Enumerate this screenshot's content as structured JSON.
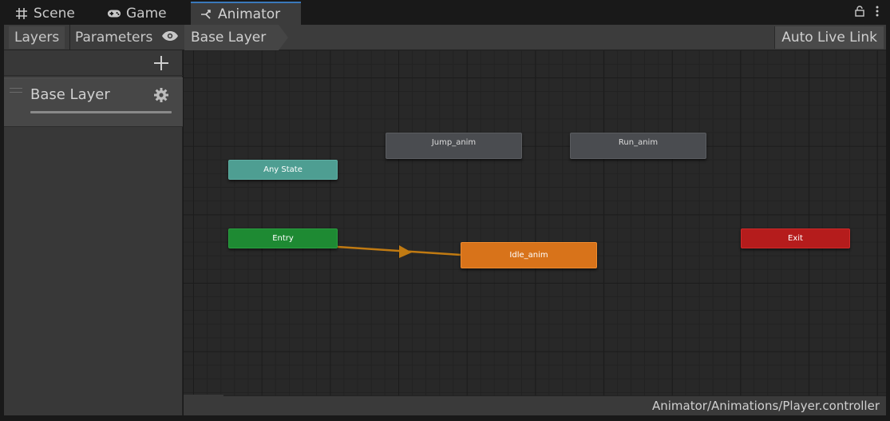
{
  "tabs": [
    {
      "label": "Scene",
      "icon": "grid-icon"
    },
    {
      "label": "Game",
      "icon": "gamepad-icon"
    },
    {
      "label": "Animator",
      "icon": "animator-icon",
      "active": true
    }
  ],
  "toolbar": {
    "layers_label": "Layers",
    "parameters_label": "Parameters",
    "breadcrumb": "Base Layer",
    "live_link_label": "Auto Live Link"
  },
  "layers": [
    {
      "name": "Base Layer"
    }
  ],
  "graph": {
    "any_state": "Any State",
    "entry": "Entry",
    "exit": "Exit",
    "states": {
      "jump": "Jump_anim",
      "run": "Run_anim",
      "idle": "Idle_anim"
    }
  },
  "footer": {
    "path": "Animator/Animations/Player.controller"
  },
  "colors": {
    "accent": "#3a79bb",
    "any_state": "#4e9e92",
    "entry": "#1e8a33",
    "exit": "#b51c1c",
    "default_state": "#d8731a",
    "transition": "#c07a12"
  }
}
